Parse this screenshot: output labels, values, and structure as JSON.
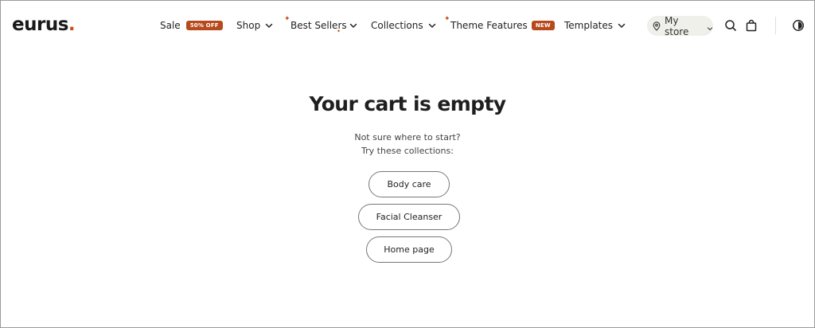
{
  "brand": {
    "name": "eurus",
    "dot": ".",
    "accent_color": "#c4501e"
  },
  "nav": {
    "sale": {
      "label": "Sale",
      "badge": "50% OFF"
    },
    "shop": {
      "label": "Shop"
    },
    "best_sellers": {
      "label": "Best Sellers"
    },
    "collections": {
      "label": "Collections"
    },
    "theme_features": {
      "label": "Theme Features",
      "badge": "NEW"
    },
    "templates": {
      "label": "Templates"
    }
  },
  "store_selector": {
    "label": "My store",
    "icon": "location-pin-icon"
  },
  "header_icons": [
    "search-icon",
    "shopping-bag-icon",
    "contrast-toggle-icon"
  ],
  "cart": {
    "title": "Your cart is empty",
    "subtitle_line1": "Not sure where to start?",
    "subtitle_line2": "Try these collections:",
    "collections": [
      {
        "label": "Body care"
      },
      {
        "label": "Facial Cleanser"
      },
      {
        "label": "Home page"
      }
    ]
  },
  "colors": {
    "badge_bg": "#b8491c",
    "pill_bg": "#eef0e9",
    "text": "#1f1f1f"
  }
}
